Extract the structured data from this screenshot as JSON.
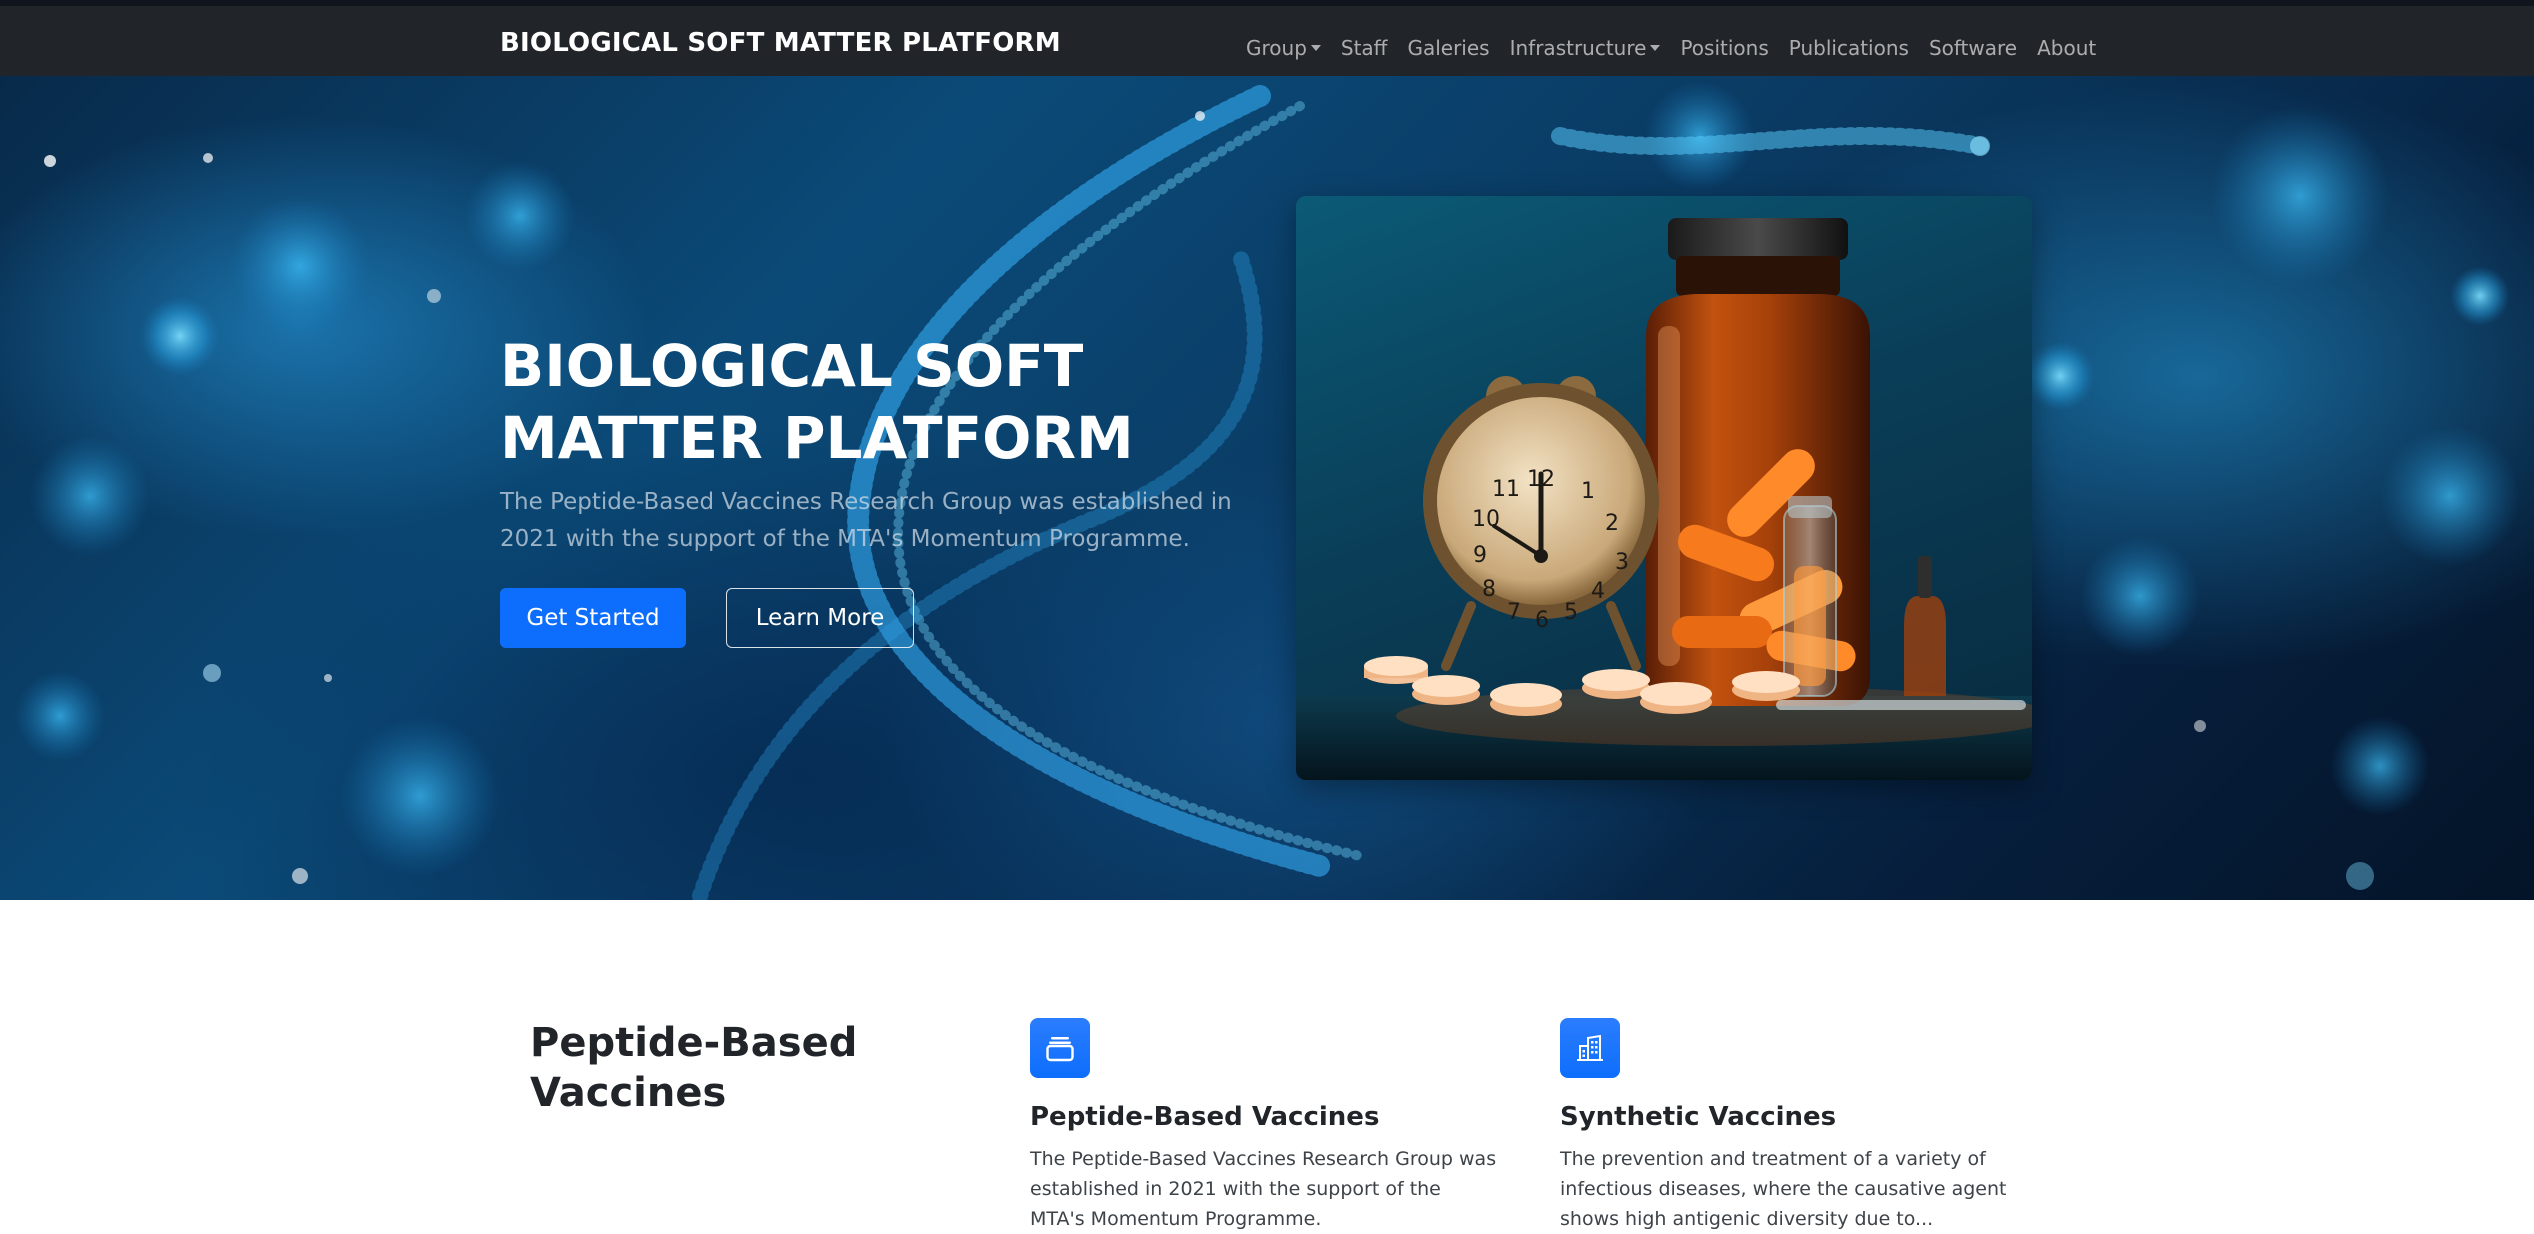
{
  "navbar": {
    "brand": "BIOLOGICAL SOFT MATTER PLATFORM",
    "links": [
      {
        "label": "Group",
        "dropdown": true
      },
      {
        "label": "Staff",
        "dropdown": false
      },
      {
        "label": "Galeries",
        "dropdown": false
      },
      {
        "label": "Infrastructure",
        "dropdown": true
      },
      {
        "label": "Positions",
        "dropdown": false
      },
      {
        "label": "Publications",
        "dropdown": false
      },
      {
        "label": "Software",
        "dropdown": false
      },
      {
        "label": "About",
        "dropdown": false
      }
    ]
  },
  "hero": {
    "title_line1": "BIOLOGICAL SOFT",
    "title_line2": "MATTER PLATFORM",
    "lead": "The Peptide-Based Vaccines Research Group was established in 2021 with the support of the MTA's Momentum Programme.",
    "primary_button": "Get Started",
    "secondary_button": "Learn More",
    "clock_numbers": [
      "12",
      "1",
      "2",
      "3",
      "4",
      "5",
      "6",
      "7",
      "8",
      "9",
      "10",
      "11"
    ]
  },
  "features": {
    "heading_line1": "Peptide-Based",
    "heading_line2": "Vaccines",
    "items": [
      {
        "icon": "collection-icon",
        "title": "Peptide-Based Vaccines",
        "text": "The Peptide-Based Vaccines Research Group was established in 2021 with the support of the MTA's Momentum Programme."
      },
      {
        "icon": "building-icon",
        "title": "Synthetic Vaccines",
        "text": "The prevention and treatment of a variety of infectious diseases, where the causative agent shows high antigenic diversity due to..."
      }
    ]
  },
  "colors": {
    "navbar_bg": "#212529",
    "primary": "#0d6efd",
    "hero_dark": "#061f3d",
    "hero_accent": "#28a0e6"
  }
}
